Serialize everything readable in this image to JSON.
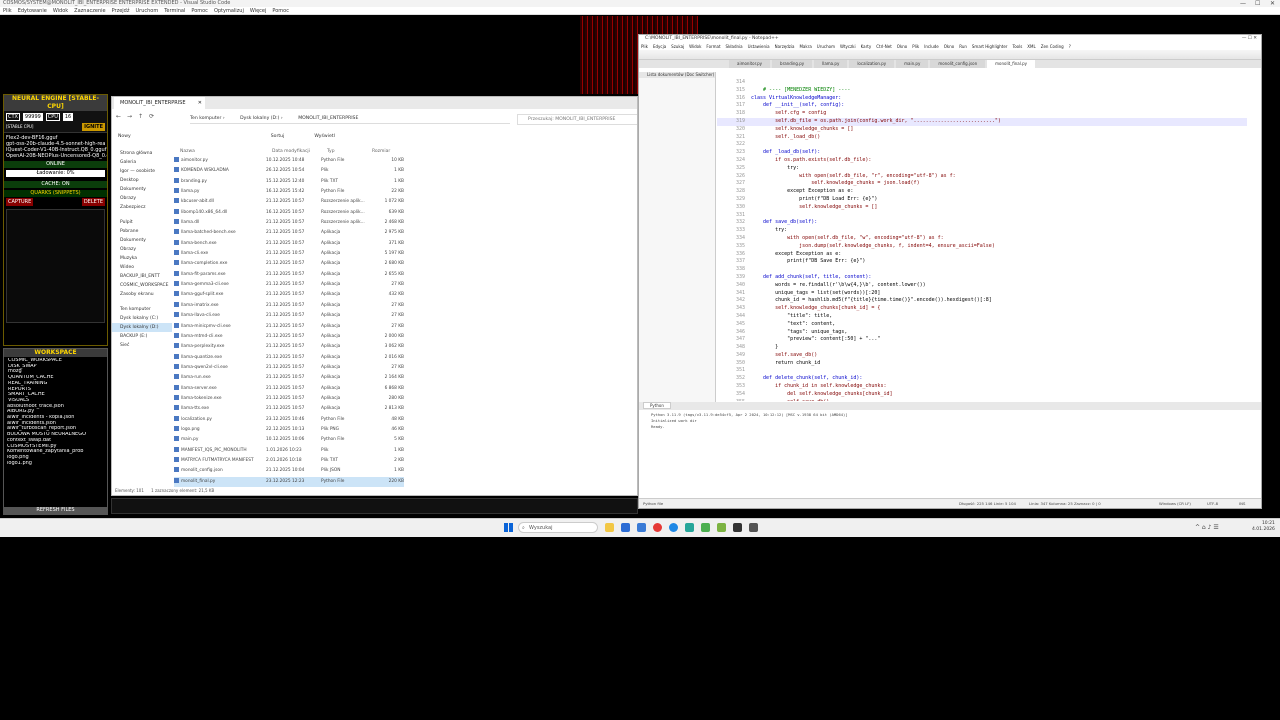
{
  "ide": {
    "title": "COSMOS/SYSTEM@MONOLIT_IBI_ENTERPRISE ENTERPRISE EXTENDED - Visual Studio Code",
    "menu": [
      "Plik",
      "Edytowanie",
      "Widok",
      "Zaznaczenie",
      "Przejdź",
      "Uruchom",
      "Terminal",
      "Pomoc",
      "Optymalizuj",
      "Więcej",
      "Pomoc"
    ]
  },
  "neural": {
    "title": "NEURAL ENGINE [STABLE-CPU]",
    "chips": [
      "CTX",
      "99999",
      "CPU",
      "16"
    ],
    "stable": "[STABLE CPU]",
    "ignite": "IGNITE",
    "models": [
      "Flex2-dev-BF16.gguf",
      "gpt-oss-20b-claude-4.5-sonnet-high-rea",
      "IQuest-Coder-V1-40B-Instruct.Q8_0.gguf",
      "OpenAI-20B-NEOPlus-Uncensored-Q8_0.gguf"
    ],
    "online": "ONLINE",
    "loading": "Ładowanie: 0%",
    "cache": "CACHE: ON",
    "quarks": "QUARKS (SNIPPETS)",
    "capture": "CAPTURE",
    "delete": "DELETE"
  },
  "workspace": {
    "title": "WORKSPACE",
    "items": [
      "COSMIC_WORKSPACE",
      "DISK_SWAP",
      "mózg",
      "QUANTUM_CACHE",
      "REAL_TRAINING",
      "REPORTS",
      "SMART_CACHE",
      "VISUALS",
      "absolutnoot_trace.json",
      "AIBORG.py",
      "aiwir_incidents - kopia.json",
      "aiwir_incidents.json",
      "aiwir_turboscan_report.json",
      "BUDOWA MOSTU NEURALNEGO",
      "context_swap.dat",
      "COSMOSYSTEMII.py",
      "Komentowane_zapytania_prob",
      "logo.png",
      "logo1.png"
    ],
    "refresh": "REFRESH FILES"
  },
  "explorer": {
    "tab_label": "MONOLIT_IBI_ENTERPRISE",
    "breadcrumb": [
      "Ten komputer",
      "Dysk lokalny (D:)",
      "MONOLIT_IBI_ENTERPRISE"
    ],
    "search_placeholder": "Przeszukaj: MONOLIT_IBI_ENTERPRISE",
    "toolbar": {
      "new": "Nowy",
      "sort": "Sortuj",
      "view": "Wyświetl"
    },
    "columns": [
      "Nazwa",
      "Data modyfikacji",
      "Typ",
      "Rozmiar"
    ],
    "nav": [
      "Strona główna",
      "Galeria",
      "Igor — osobiste",
      "Desktop",
      "Dokumenty",
      "Obrazy",
      "Zabezpiecz",
      "Pulpit",
      "Pobrane",
      "Dokumenty",
      "Obrazy",
      "Muzyka",
      "Wideo",
      "BACKUP_IBI_ENTT",
      "COSMIC_WORKSPACE",
      "Zasoby ekranu",
      "Ten komputer",
      "Dysk lokalny (C:)",
      "Dysk lokalny (D:)",
      "BACKUP (E:)",
      "Sieć"
    ],
    "files": [
      [
        "aimonitor.py",
        "10.12.2025 10:48",
        "Python File",
        "10 KB"
      ],
      [
        "KOMENDA WSKLADNA",
        "26.12.2025 10:54",
        "Plik",
        "1 KB"
      ],
      [
        "branding.py",
        "15.12.2025 12:40",
        "Plik TXT",
        "1 KB"
      ],
      [
        "llama.py",
        "16.12.2025 15:42",
        "Python File",
        "22 KB"
      ],
      [
        "kbcuser-abit.dll",
        "21.12.2025 10:57",
        "Rozszerzenie aplik...",
        "1 072 KB"
      ],
      [
        "libomp140.x86_64.dll",
        "16.12.2025 10:57",
        "Rozszerzenie aplik...",
        "639 KB"
      ],
      [
        "llama.dll",
        "21.12.2025 10:57",
        "Rozszerzenie aplik...",
        "2 468 KB"
      ],
      [
        "llama-batched-bench.exe",
        "21.12.2025 10:57",
        "Aplikacja",
        "2 975 KB"
      ],
      [
        "llama-bench.exe",
        "21.12.2025 10:57",
        "Aplikacja",
        "371 KB"
      ],
      [
        "llama-cli.exe",
        "21.12.2025 10:57",
        "Aplikacja",
        "5 197 KB"
      ],
      [
        "llama-completion.exe",
        "21.12.2025 10:57",
        "Aplikacja",
        "2 680 KB"
      ],
      [
        "llama-fit-params.exe",
        "21.12.2025 10:57",
        "Aplikacja",
        "2 655 KB"
      ],
      [
        "llama-gemma3-cli.exe",
        "21.12.2025 10:57",
        "Aplikacja",
        "27 KB"
      ],
      [
        "llama-gguf-split.exe",
        "21.12.2025 10:57",
        "Aplikacja",
        "432 KB"
      ],
      [
        "llama-imatrix.exe",
        "21.12.2025 10:57",
        "Aplikacja",
        "27 KB"
      ],
      [
        "llama-llava-cli.exe",
        "21.12.2025 10:57",
        "Aplikacja",
        "27 KB"
      ],
      [
        "llama-minicpmv-cli.exe",
        "21.12.2025 10:57",
        "Aplikacja",
        "27 KB"
      ],
      [
        "llama-mtmd-cli.exe",
        "21.12.2025 10:57",
        "Aplikacja",
        "2 000 KB"
      ],
      [
        "llama-perplexity.exe",
        "21.12.2025 10:57",
        "Aplikacja",
        "3 062 KB"
      ],
      [
        "llama-quantize.exe",
        "21.12.2025 10:57",
        "Aplikacja",
        "2 016 KB"
      ],
      [
        "llama-qwen2vl-cli.exe",
        "21.12.2025 10:57",
        "Aplikacja",
        "27 KB"
      ],
      [
        "llama-run.exe",
        "21.12.2025 10:57",
        "Aplikacja",
        "2 164 KB"
      ],
      [
        "llama-server.exe",
        "21.12.2025 10:57",
        "Aplikacja",
        "6 868 KB"
      ],
      [
        "llama-tokenize.exe",
        "21.12.2025 10:57",
        "Aplikacja",
        "280 KB"
      ],
      [
        "llama-tts.exe",
        "21.12.2025 10:57",
        "Aplikacja",
        "2 813 KB"
      ],
      [
        "localization.py",
        "23.12.2025 10:46",
        "Python File",
        "48 KB"
      ],
      [
        "logo.png",
        "22.12.2025 10:13",
        "Plik PNG",
        "46 KB"
      ],
      [
        "main.py",
        "10.12.2025 10:06",
        "Python File",
        "5 KB"
      ],
      [
        "MANIFEST_IQS_PIC_MONOLITH",
        "1.01.2026 10:23",
        "Plik",
        "1 KB"
      ],
      [
        "MATRYCA FUTMATRYCA MANIFEST",
        "2.01.2026 10:18",
        "Plik TXT",
        "2 KB"
      ],
      [
        "monolit_config.json",
        "21.12.2025 10:04",
        "Plik JSON",
        "1 KB"
      ],
      [
        "monolit_final.py",
        "23.12.2025 12:23",
        "Python File",
        "220 KB"
      ]
    ],
    "status_count": "Elementy: 101",
    "status_selected": "1 zaznaczony element: 21,5 KB"
  },
  "editor": {
    "title": "C:\\MONOLIT_IBI_ENTERPRISE\\monolit_final.py - Notepad++",
    "menu": [
      "Plik",
      "Edycja",
      "Szukaj",
      "Widok",
      "Format",
      "Składnia",
      "Ustawienia",
      "Narzędzia",
      "Makra",
      "Uruchom",
      "Wtyczki",
      "Karty",
      "Ctrl-Net",
      "Okno",
      "Plik",
      "Include",
      "Okno",
      "Run",
      "Smart Highlighter",
      "Tools",
      "XML",
      "Zen Coding",
      "?"
    ],
    "tabs": [
      "aimonitor.py",
      "branding.py",
      "llama.py",
      "localization.py",
      "main.py",
      "monolit_config.json",
      "monolit_final.py"
    ],
    "side_label": "Lista dokumentów (Doc Switcher)",
    "code": [
      [
        "314",
        ""
      ],
      [
        "315",
        "    # ---- [MENEDŻER WIEDZY] ----"
      ],
      [
        "316",
        "class VirtualKnowledgeManager:"
      ],
      [
        "317",
        "    def __init__(self, config):"
      ],
      [
        "318",
        "        self.cfg = config"
      ],
      [
        "319",
        "        self.db_file = os.path.join(config.work_dir, \"...........................\")"
      ],
      [
        "320",
        "        self.knowledge_chunks = []"
      ],
      [
        "321",
        "        self._load_db()"
      ],
      [
        "322",
        ""
      ],
      [
        "323",
        "    def _load_db(self):"
      ],
      [
        "324",
        "        if os.path.exists(self.db_file):"
      ],
      [
        "325",
        "            try:"
      ],
      [
        "326",
        "                with open(self.db_file, \"r\", encoding=\"utf-8\") as f:"
      ],
      [
        "327",
        "                    self.knowledge_chunks = json.load(f)"
      ],
      [
        "328",
        "            except Exception as e:"
      ],
      [
        "329",
        "                print(f\"DB Load Err: {e}\")"
      ],
      [
        "330",
        "                self.knowledge_chunks = []"
      ],
      [
        "331",
        ""
      ],
      [
        "332",
        "    def save_db(self):"
      ],
      [
        "333",
        "        try:"
      ],
      [
        "334",
        "            with open(self.db_file, \"w\", encoding=\"utf-8\") as f:"
      ],
      [
        "335",
        "                json.dump(self.knowledge_chunks, f, indent=4, ensure_ascii=False)"
      ],
      [
        "336",
        "        except Exception as e:"
      ],
      [
        "337",
        "            print(f\"DB Save Err: {e}\")"
      ],
      [
        "338",
        ""
      ],
      [
        "339",
        "    def add_chunk(self, title, content):"
      ],
      [
        "340",
        "        words = re.findall(r'\\b\\w{4,}\\b', content.lower())"
      ],
      [
        "341",
        "        unique_tags = list(set(words))[:20]"
      ],
      [
        "342",
        "        chunk_id = hashlib.md5(f\"{title}{time.time()}\".encode()).hexdigest()[:8]"
      ],
      [
        "343",
        "        self.knowledge_chunks[chunk_id] = {"
      ],
      [
        "344",
        "            \"title\": title,"
      ],
      [
        "345",
        "            \"text\": content,"
      ],
      [
        "346",
        "            \"tags\": unique_tags,"
      ],
      [
        "347",
        "            \"preview\": content[:50] + \"...\""
      ],
      [
        "348",
        "        }"
      ],
      [
        "349",
        "        self.save_db()"
      ],
      [
        "350",
        "        return chunk_id"
      ],
      [
        "351",
        ""
      ],
      [
        "352",
        "    def delete_chunk(self, chunk_id):"
      ],
      [
        "353",
        "        if chunk_id in self.knowledge_chunks:"
      ],
      [
        "354",
        "            del self.knowledge_chunks[chunk_id]"
      ],
      [
        "355",
        "            self.save_db()"
      ]
    ],
    "console_tab": "Python",
    "console_lines": [
      "Python 3.11.9 (tags/v3.11.9:de54cf5, Apr  2 2024, 10:12:12) [MSC v.1938 64 bit (AMD64)]",
      "Initialized work dir",
      "Ready."
    ],
    "status": {
      "lang": "Python file",
      "pos": "Długość: 225 146    Linie: 5 104",
      "ln": "Linia: 347    Kolumna: 25    Zaznacz: 0 | 0",
      "eol": "Windows (CR LF)",
      "enc": "UTF-8",
      "ins": "INS"
    }
  },
  "taskbar": {
    "search_placeholder": "Wyszukaj",
    "time": "10:21",
    "date": "4.01.2026"
  }
}
